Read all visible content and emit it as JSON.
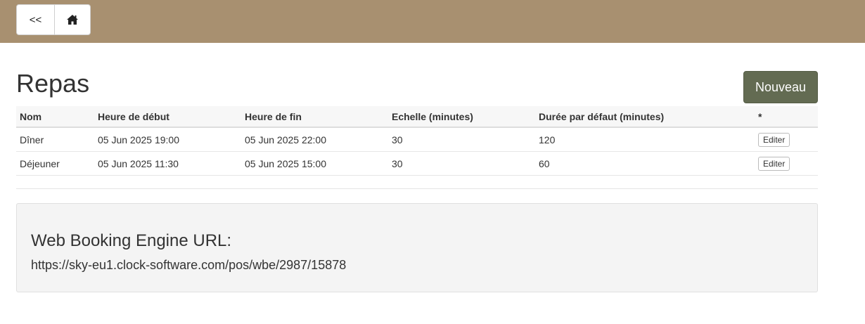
{
  "nav": {
    "back_label": "<<",
    "home_icon": "home-icon"
  },
  "page": {
    "title": "Repas",
    "new_button_label": "Nouveau"
  },
  "table": {
    "columns": [
      "Nom",
      "Heure de début",
      "Heure de fin",
      "Echelle (minutes)",
      "Durée par défaut (minutes)",
      "*"
    ],
    "rows": [
      {
        "name": "Dîner",
        "start": "05 Jun 2025 19:00",
        "end": "05 Jun 2025 22:00",
        "scale": "30",
        "duration": "120",
        "action": "Editer"
      },
      {
        "name": "Déjeuner",
        "start": "05 Jun 2025 11:30",
        "end": "05 Jun 2025 15:00",
        "scale": "30",
        "duration": "60",
        "action": "Editer"
      }
    ]
  },
  "booking": {
    "heading": "Web Booking Engine URL:",
    "url": "https://sky-eu1.clock-software.com/pos/wbe/2987/15878"
  },
  "colors": {
    "topbar": "#a89070",
    "primary_button": "#636b52"
  }
}
